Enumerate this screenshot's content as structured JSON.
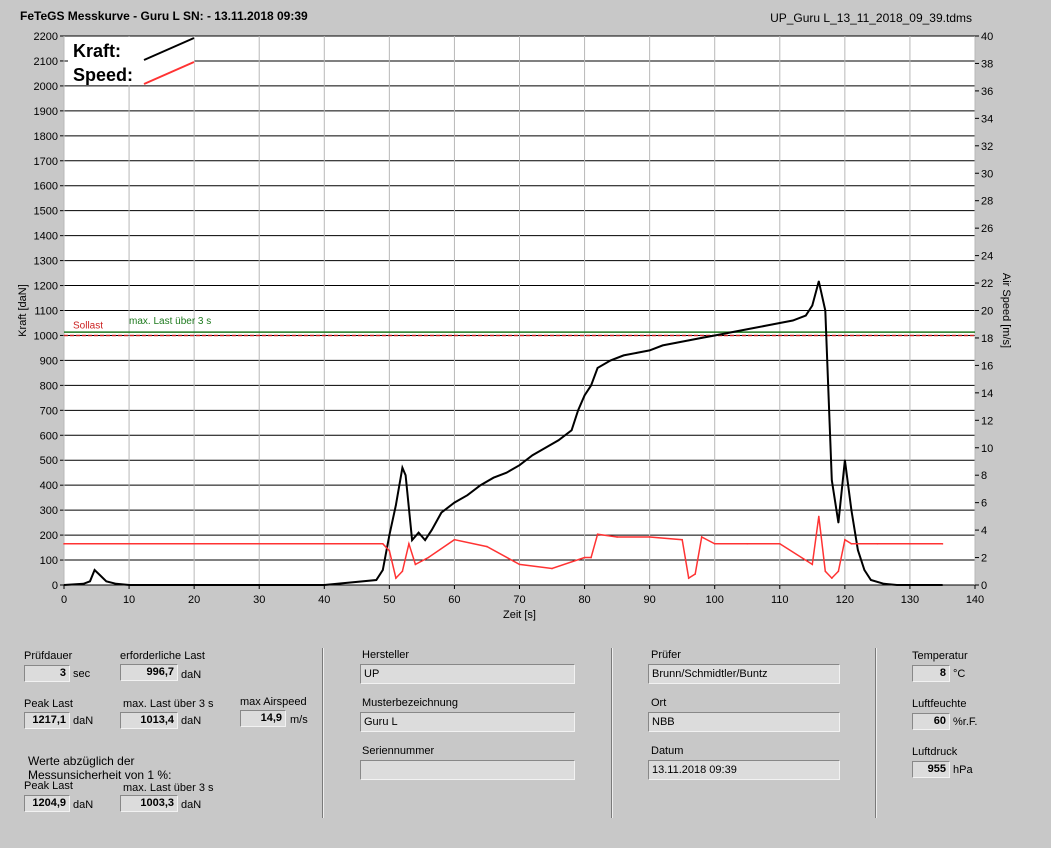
{
  "header": {
    "title": "FeTeGS Messkurve - Guru L  SN:  - 13.11.2018 09:39",
    "filename": "UP_Guru L_13_11_2018_09_39.tdms"
  },
  "legend": {
    "kraft": "Kraft:",
    "speed": "Speed:"
  },
  "annotations": {
    "sollast": "Sollast",
    "max_last": "max. Last über  3 s"
  },
  "colors": {
    "kraft": "#000000",
    "speed": "#ff3333",
    "sollast": "#cc2222",
    "max_last": "#1e7a1e",
    "plot_bg": "#ffffff",
    "panel_bg": "#c8c8c8"
  },
  "chart_data": {
    "type": "line",
    "xlabel": "Zeit [s]",
    "ylabel": "Kraft [daN]",
    "y2label": "Air Speed [m/s]",
    "xlim": [
      0,
      140
    ],
    "ylim": [
      0,
      2200
    ],
    "y2lim": [
      0,
      40
    ],
    "xticks": [
      "0",
      "10",
      "20",
      "30",
      "40",
      "50",
      "60",
      "70",
      "80",
      "90",
      "100",
      "110",
      "120",
      "130",
      "140"
    ],
    "yticks": [
      "0",
      "100",
      "200",
      "300",
      "400",
      "500",
      "600",
      "700",
      "800",
      "900",
      "1000",
      "1100",
      "1200",
      "1300",
      "1400",
      "1500",
      "1600",
      "1700",
      "1800",
      "1900",
      "2000",
      "2100",
      "2200"
    ],
    "y2ticks": [
      "0",
      "2",
      "4",
      "6",
      "8",
      "10",
      "12",
      "14",
      "16",
      "18",
      "20",
      "22",
      "24",
      "26",
      "28",
      "30",
      "32",
      "34",
      "36",
      "38",
      "40"
    ],
    "reference_lines": [
      {
        "name": "Sollast",
        "y": 1000
      },
      {
        "name": "max. Last über  3 s",
        "y": 1013.4
      }
    ],
    "series": [
      {
        "name": "Kraft",
        "axis": "left",
        "x": [
          0,
          3,
          4,
          4.7,
          5.5,
          6.5,
          8,
          10,
          20,
          30,
          40,
          48,
          49,
          50,
          51,
          52,
          52.5,
          53.5,
          54.5,
          55.5,
          56.5,
          58,
          60,
          62,
          64,
          66,
          68,
          70,
          72,
          74,
          76,
          78,
          79,
          80,
          81,
          82,
          84,
          86,
          88,
          90,
          92,
          94,
          96,
          98,
          100,
          102,
          104,
          106,
          108,
          110,
          112,
          114,
          115,
          116,
          117,
          118,
          119,
          120,
          121,
          122,
          123,
          124,
          126,
          128,
          130,
          135
        ],
        "y": [
          0,
          5,
          15,
          60,
          40,
          15,
          5,
          0,
          0,
          0,
          0,
          20,
          60,
          200,
          320,
          470,
          440,
          180,
          210,
          180,
          220,
          290,
          330,
          360,
          400,
          430,
          450,
          480,
          520,
          550,
          580,
          620,
          700,
          760,
          800,
          870,
          900,
          920,
          930,
          940,
          960,
          970,
          980,
          990,
          1000,
          1010,
          1020,
          1030,
          1040,
          1050,
          1060,
          1080,
          1120,
          1217,
          1100,
          420,
          250,
          500,
          300,
          140,
          60,
          20,
          5,
          0,
          0,
          0
        ]
      },
      {
        "name": "Speed",
        "axis": "right",
        "x": [
          0,
          49,
          50,
          51,
          52,
          53,
          54,
          56,
          60,
          65,
          70,
          75,
          80,
          81,
          82,
          85,
          90,
          95,
          96,
          97,
          98,
          100,
          105,
          110,
          115,
          116,
          117,
          118,
          119,
          120,
          121,
          122,
          125,
          130,
          135
        ],
        "y": [
          3,
          3,
          2.5,
          0.5,
          1,
          3,
          1.5,
          2,
          3.3,
          2.8,
          1.5,
          1.2,
          2,
          2,
          3.7,
          3.5,
          3.5,
          3.3,
          0.5,
          0.8,
          3.5,
          3,
          3,
          3,
          1.5,
          5,
          1,
          0.5,
          1,
          3.3,
          3,
          3,
          3,
          3,
          3
        ]
      }
    ]
  },
  "panel": {
    "pruefdauer": {
      "label": "Prüfdauer",
      "value": "3",
      "unit": "sec"
    },
    "erf_last": {
      "label": "erforderliche Last",
      "value": "996,7",
      "unit": "daN"
    },
    "peak_last": {
      "label": "Peak Last",
      "value": "1217,1",
      "unit": "daN"
    },
    "max_last": {
      "label": "max. Last über  3 s",
      "value": "1013,4",
      "unit": "daN"
    },
    "max_airspeed": {
      "label": "max Airspeed",
      "value": "14,9",
      "unit": "m/s"
    },
    "werte_note_1": "Werte abzüglich der",
    "werte_note_2": "Messunsicherheit von 1  %:",
    "peak_last_2": {
      "label": "Peak Last",
      "value": "1204,9",
      "unit": "daN"
    },
    "max_last_2": {
      "label": "max. Last über  3 s",
      "value": "1003,3",
      "unit": "daN"
    },
    "hersteller": {
      "label": "Hersteller",
      "value": "UP"
    },
    "musterbezeichnung": {
      "label": "Musterbezeichnung",
      "value": "Guru L"
    },
    "seriennummer": {
      "label": "Seriennummer",
      "value": ""
    },
    "pruefer": {
      "label": "Prüfer",
      "value": "Brunn/Schmidtler/Buntz"
    },
    "ort": {
      "label": "Ort",
      "value": "NBB"
    },
    "datum": {
      "label": "Datum",
      "value": "13.11.2018 09:39"
    },
    "temperatur": {
      "label": "Temperatur",
      "value": "8",
      "unit": "°C"
    },
    "luftfeuchte": {
      "label": "Luftfeuchte",
      "value": "60",
      "unit": "%r.F."
    },
    "luftdruck": {
      "label": "Luftdruck",
      "value": "955",
      "unit": "hPa"
    }
  }
}
